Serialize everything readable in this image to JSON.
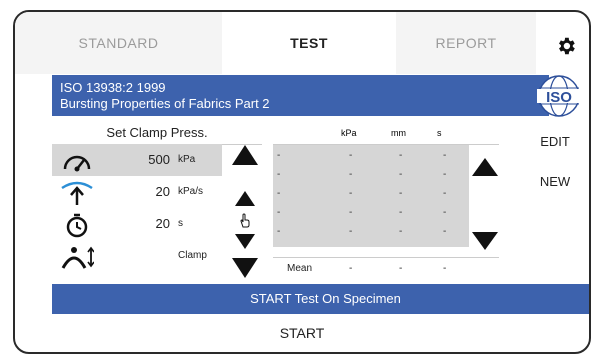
{
  "tabs": {
    "standard": "STANDARD",
    "test": "TEST",
    "report": "REPORT"
  },
  "banner": {
    "line1": "ISO 13938:2 1999",
    "line2": "Bursting Properties of Fabrics Part 2",
    "logo_text": "ISO"
  },
  "side_buttons": {
    "edit": "EDIT",
    "new": "NEW"
  },
  "params": {
    "heading": "Set Clamp Press.",
    "rows": [
      {
        "icon": "gauge-icon",
        "value": "500",
        "unit": "kPa"
      },
      {
        "icon": "pressure-rate-icon",
        "value": "20",
        "unit": "kPa/s"
      },
      {
        "icon": "timer-icon",
        "value": "20",
        "unit": "s"
      },
      {
        "icon": "clamp-icon",
        "value": "",
        "unit": "Clamp"
      }
    ]
  },
  "results": {
    "columns": [
      "kPa",
      "mm",
      "s"
    ],
    "rows": [
      [
        "-",
        "-",
        "-",
        "-"
      ],
      [
        "-",
        "-",
        "-",
        "-"
      ],
      [
        "-",
        "-",
        "-",
        "-"
      ],
      [
        "-",
        "-",
        "-",
        "-"
      ],
      [
        "-",
        "-",
        "-",
        "-"
      ]
    ],
    "mean": {
      "label": "Mean",
      "values": [
        "-",
        "-",
        "-"
      ]
    }
  },
  "status_bar": "START Test On Specimen",
  "start_button": "START",
  "colors": {
    "accent": "#3d62ad",
    "shade": "#d6d6d6"
  }
}
